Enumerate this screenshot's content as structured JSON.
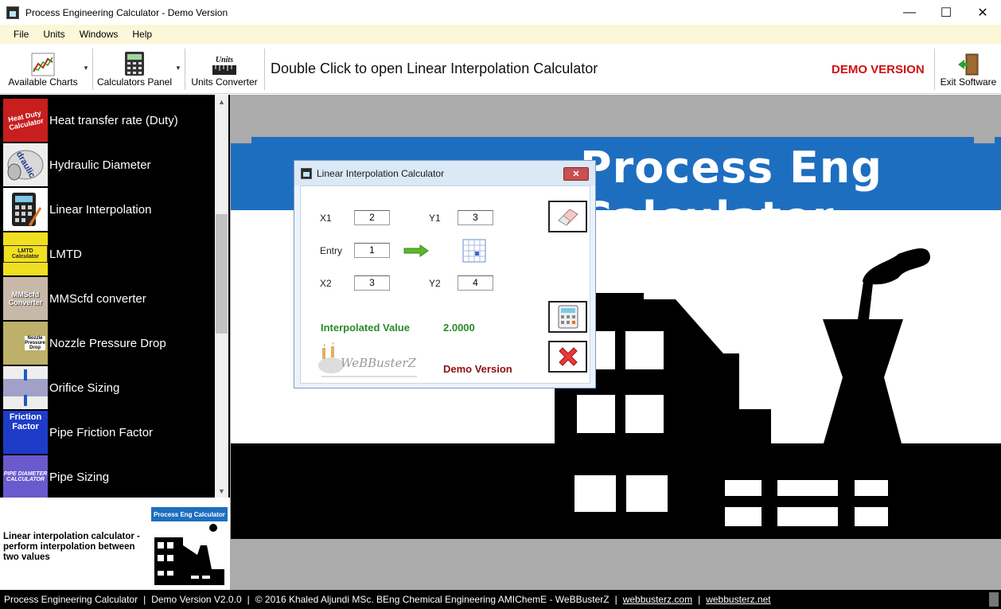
{
  "window": {
    "title": "Process Engineering Calculator - Demo Version",
    "minimize_glyph": "—",
    "maximize_glyph": "☐",
    "close_glyph": "✕"
  },
  "menu": [
    "File",
    "Units",
    "Windows",
    "Help"
  ],
  "toolbar": {
    "available_charts": "Available Charts",
    "calculators_panel": "Calculators Panel",
    "units_converter": "Units Converter",
    "hint": "Double Click to open Linear Interpolation Calculator",
    "demo_badge": "DEMO VERSION",
    "exit": "Exit Software"
  },
  "calculator_list": [
    {
      "label": "Heat transfer rate (Duty)",
      "thumb_text": "Heat Duty Calculator",
      "icon": "heat-duty-icon"
    },
    {
      "label": "Hydraulic Diameter",
      "thumb_text": "draulic",
      "icon": "hydraulic-diameter-icon"
    },
    {
      "label": "Linear Interpolation",
      "thumb_text": "",
      "icon": "calculator-icon"
    },
    {
      "label": "LMTD",
      "thumb_text": "LMTD Calculator",
      "icon": "lmtd-icon"
    },
    {
      "label": "MMScfd converter",
      "thumb_text": "MMScfd Converter",
      "icon": "mmscfd-icon"
    },
    {
      "label": "Nozzle Pressure Drop",
      "thumb_text": "Nozzle Pressure Drop",
      "icon": "nozzle-icon"
    },
    {
      "label": "Orifice Sizing",
      "thumb_text": "",
      "icon": "orifice-icon"
    },
    {
      "label": "Pipe Friction Factor",
      "thumb_text": "Friction Factor",
      "icon": "friction-factor-icon"
    },
    {
      "label": "Pipe Sizing",
      "thumb_text": "PIPE DIAMETER CALCULATOR",
      "icon": "pipe-sizing-icon"
    }
  ],
  "description": {
    "text": "Linear interpolation calculator - perform interpolation between two values",
    "logo_text": "Process Eng Calculator"
  },
  "banner": {
    "title": "Process Eng Calculator"
  },
  "dialog": {
    "title": "Linear Interpolation Calculator",
    "close_glyph": "✕",
    "x1_label": "X1",
    "x1_value": "2",
    "y1_label": "Y1",
    "y1_value": "3",
    "entry_label": "Entry",
    "entry_value": "1",
    "x2_label": "X2",
    "x2_value": "3",
    "y2_label": "Y2",
    "y2_value": "4",
    "interpolated_label": "Interpolated Value",
    "interpolated_value": "2.0000",
    "demo_text": "Demo Version",
    "logo_text": "WeBBusterZ"
  },
  "status": {
    "app": "Process Engineering Calculator",
    "version": "Demo Version V2.0.0",
    "copyright": "© 2016 Khaled Aljundi MSc. BEng Chemical Engineering AMIChemE - WeBBusterZ",
    "link1": "webbusterz.com",
    "link2": "webbusterz.net"
  },
  "colors": {
    "demo_red": "#d01010",
    "banner_blue": "#1e6ec0",
    "result_green": "#2a8a2a"
  }
}
